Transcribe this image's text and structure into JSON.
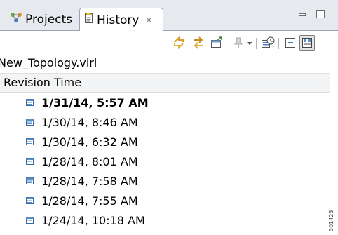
{
  "tabs": [
    {
      "label": "Projects",
      "icon": "projects-icon",
      "active": false
    },
    {
      "label": "History",
      "icon": "history-icon",
      "active": true,
      "close_glyph": "⨯"
    }
  ],
  "window_buttons": {
    "minimize": "minimize-icon",
    "maximize": "maximize-icon"
  },
  "toolbar": {
    "icons": [
      "compare-icon",
      "link-editor-icon",
      "open-revision-icon",
      "pin-icon",
      "dropdown-arrow-icon",
      "filter-history-icon",
      "collapse-icon",
      "layout-icon"
    ]
  },
  "file": {
    "name": "New_Topology.virl"
  },
  "table": {
    "column_header": "Revision Time",
    "rows": [
      {
        "time": "1/31/14, 5:57 AM",
        "current": true
      },
      {
        "time": "1/30/14, 8:46 AM",
        "current": false
      },
      {
        "time": "1/30/14, 6:32 AM",
        "current": false
      },
      {
        "time": "1/28/14, 8:01 AM",
        "current": false
      },
      {
        "time": "1/28/14, 7:58 AM",
        "current": false
      },
      {
        "time": "1/28/14, 7:55 AM",
        "current": false
      },
      {
        "time": "1/24/14, 10:18 AM",
        "current": false
      }
    ]
  },
  "side_mark": "301423",
  "colors": {
    "accent": "#5a8fc8",
    "tab_bg": "#e6e9ed",
    "border": "#9aa5b1"
  }
}
